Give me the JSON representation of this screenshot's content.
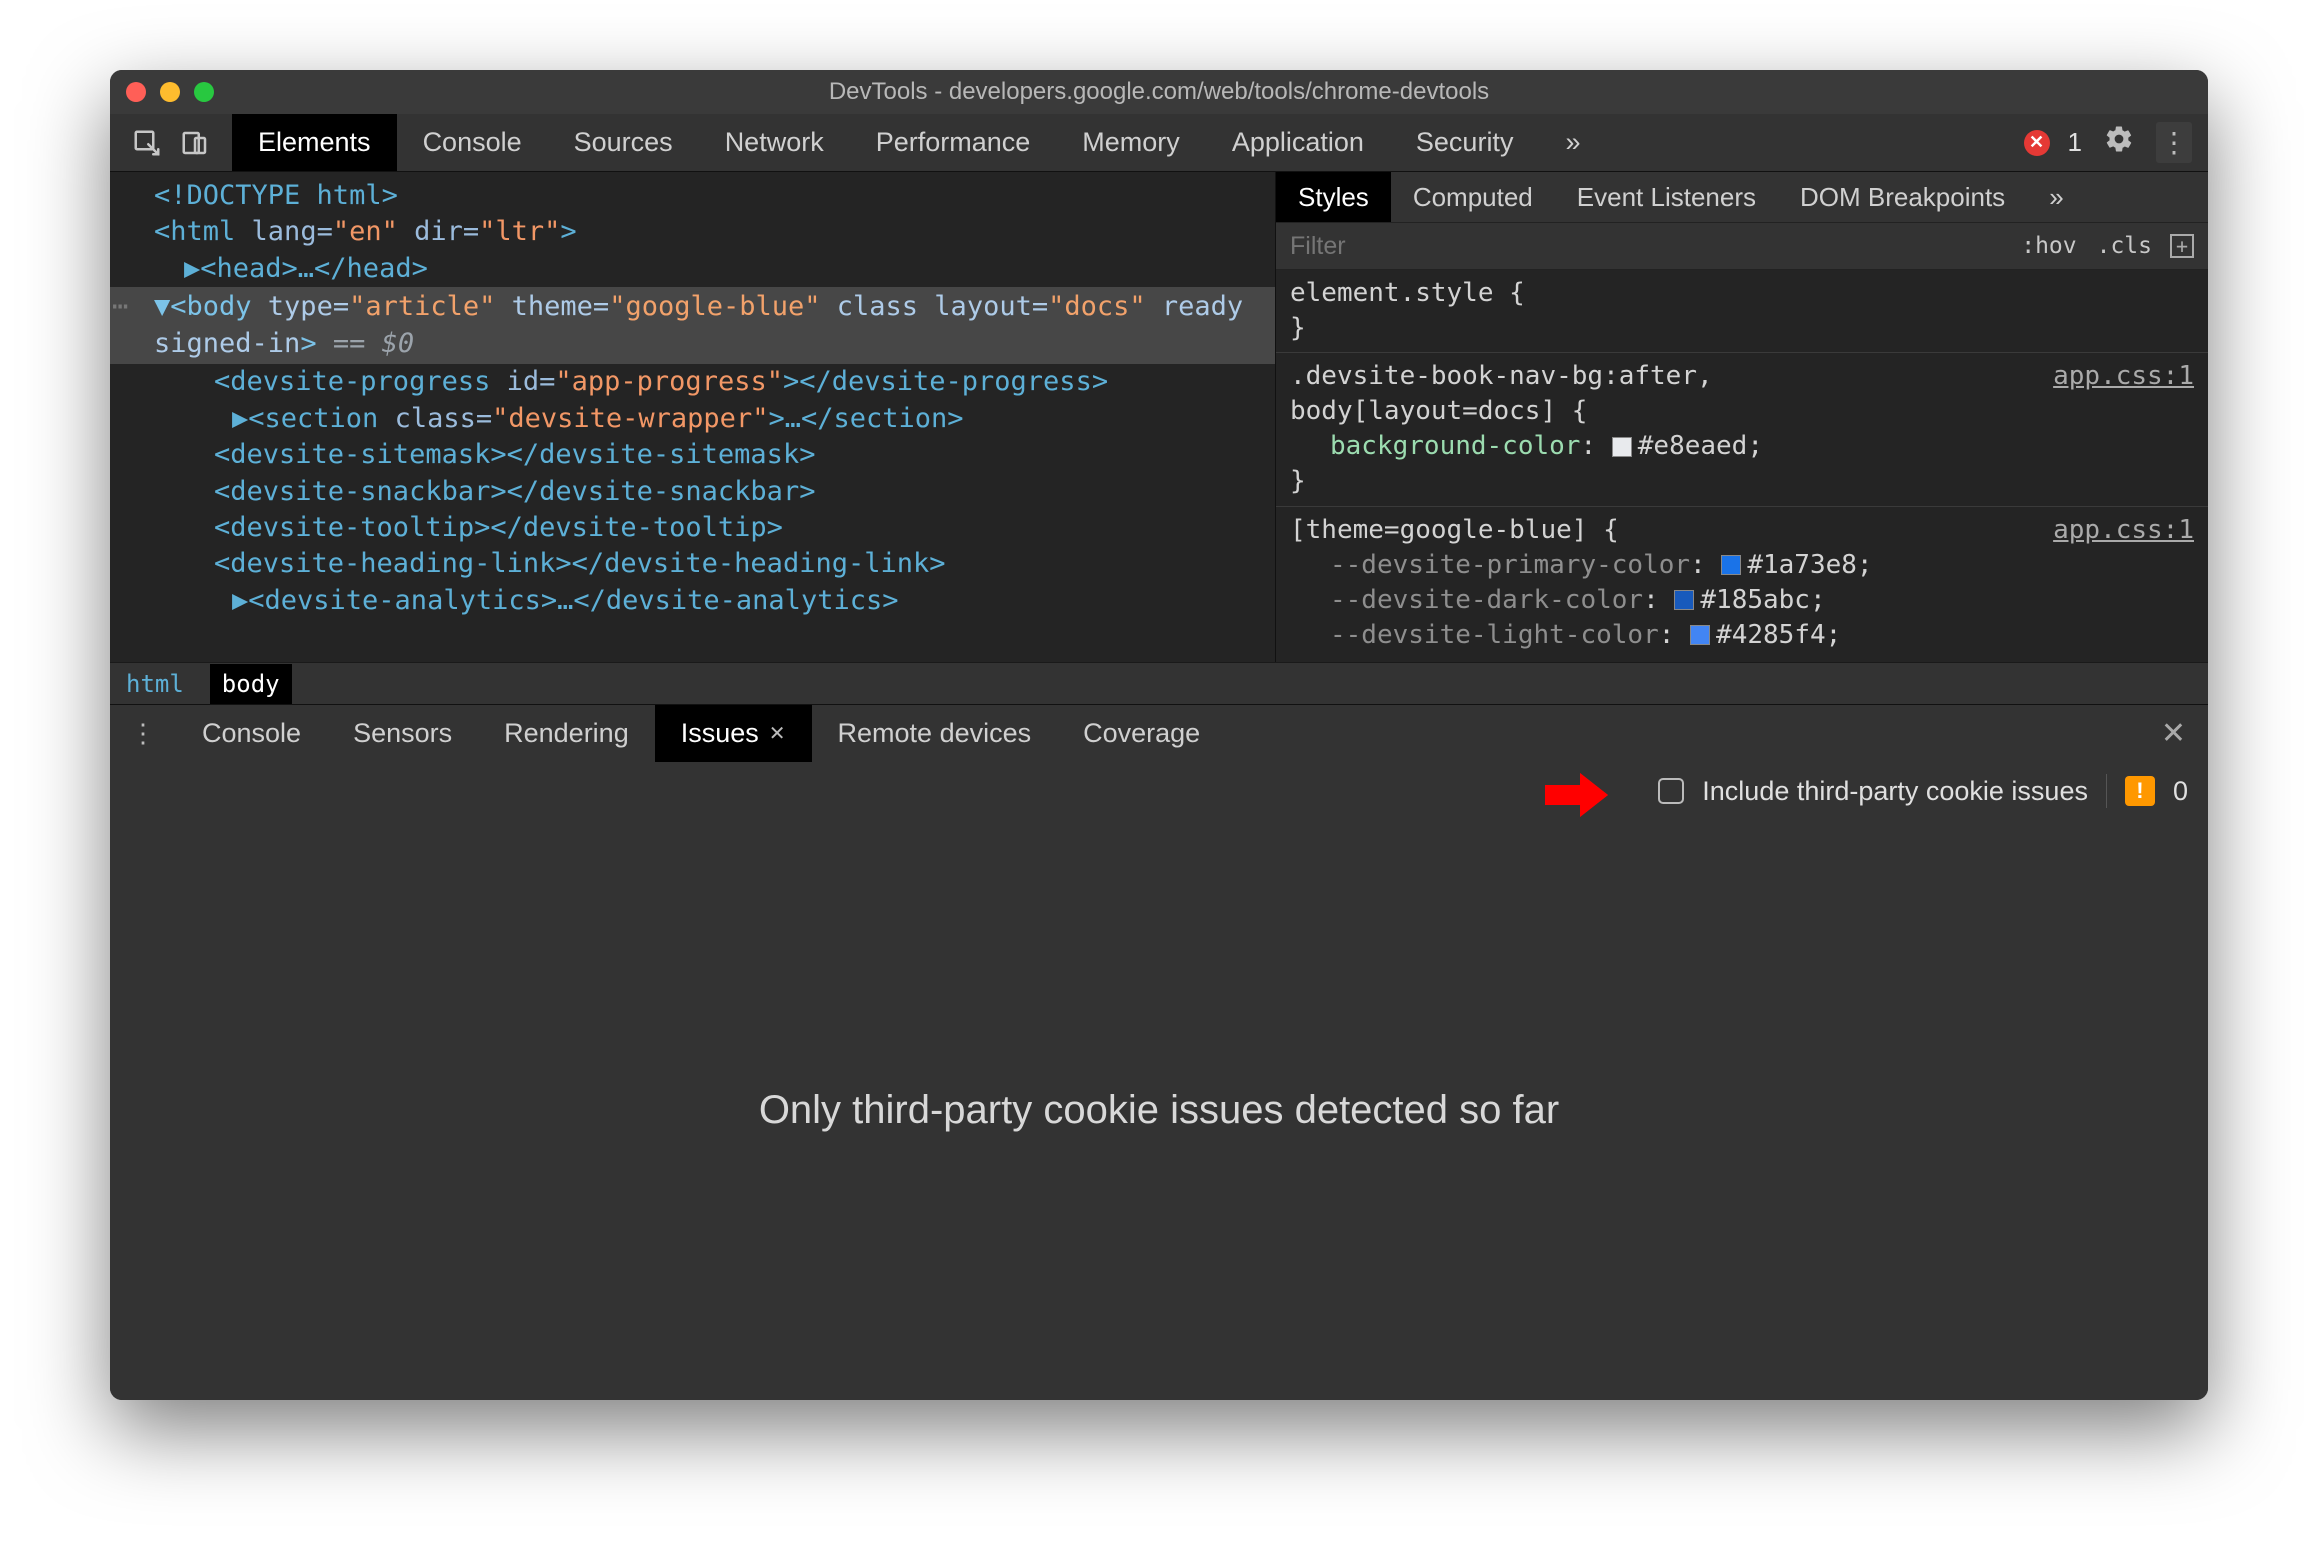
{
  "window_title": "DevTools - developers.google.com/web/tools/chrome-devtools",
  "toolbar": {
    "tabs": [
      "Elements",
      "Console",
      "Sources",
      "Network",
      "Performance",
      "Memory",
      "Application",
      "Security"
    ],
    "active_tab_index": 0,
    "overflow_glyph": "»",
    "error_count": "1"
  },
  "dom": {
    "line0": "<!DOCTYPE html>",
    "line1_open": "<html ",
    "line1_attr1_name": "lang=",
    "line1_attr1_val": "\"en\"",
    "line1_attr2_name": " dir=",
    "line1_attr2_val": "\"ltr\"",
    "line1_close": ">",
    "line2": "▶<head>…</head>",
    "body_open": "▼<body ",
    "body_attr1n": "type=",
    "body_attr1v": "\"article\"",
    "body_attr2n": " theme=",
    "body_attr2v": "\"google-blue\"",
    "body_attr3n": " class layout=",
    "body_attr3v": "\"docs\"",
    "body_line2": "ready signed-in",
    "body_close": ">",
    "eq": " == $0",
    "c1_open": "<devsite-progress ",
    "c1_attr_n": "id=",
    "c1_attr_v": "\"app-progress\"",
    "c1_close": "></devsite-progress>",
    "c2_open": "▶<section ",
    "c2_attr_n": "class=",
    "c2_attr_v": "\"devsite-wrapper\"",
    "c2_close": ">…</section>",
    "c3": "<devsite-sitemask></devsite-sitemask>",
    "c4": "<devsite-snackbar></devsite-snackbar>",
    "c5": "<devsite-tooltip></devsite-tooltip>",
    "c6": "<devsite-heading-link></devsite-heading-link>",
    "c7": "▶<devsite-analytics>…</devsite-analytics>"
  },
  "breadcrumb": {
    "html": "html",
    "body": "body"
  },
  "styles": {
    "tabs": [
      "Styles",
      "Computed",
      "Event Listeners",
      "DOM Breakpoints"
    ],
    "active_tab_index": 0,
    "overflow_glyph": "»",
    "filter_placeholder": "Filter",
    "hov": ":hov",
    "cls": ".cls",
    "rule1_sel": "element.style {",
    "rule1_close": "}",
    "rule2_sel1": ".devsite-book-nav-bg:after,",
    "rule2_sel2": "body[layout=docs] {",
    "rule2_src": "app.css:1",
    "rule2_prop": "background-color",
    "rule2_val": "#e8eaed",
    "rule2_swatch": "#e8eaed",
    "rule2_close": "}",
    "rule3_sel": "[theme=google-blue] {",
    "rule3_src": "app.css:1",
    "rule3_p1": "--devsite-primary-color",
    "rule3_v1": "#1a73e8",
    "rule3_p2": "--devsite-dark-color",
    "rule3_v2": "#185abc",
    "rule3_p3": "--devsite-light-color",
    "rule3_v3": "#4285f4"
  },
  "drawer": {
    "tabs": [
      "Console",
      "Sensors",
      "Rendering",
      "Issues",
      "Remote devices",
      "Coverage"
    ],
    "active_tab_index": 3
  },
  "issues": {
    "checkbox_label": "Include third-party cookie issues",
    "count": "0",
    "body_message": "Only third-party cookie issues detected so far"
  }
}
